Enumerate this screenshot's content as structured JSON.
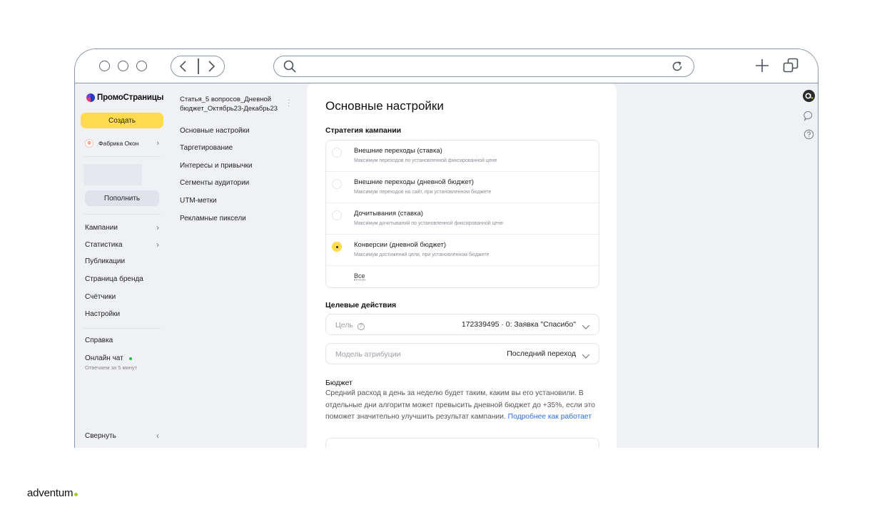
{
  "sidebar": {
    "logo": "ПромоСтраницы",
    "create_label": "Создать",
    "account_name": "Фабрика Окон",
    "account_avatar_letter": "Ф",
    "topup_label": "Пополнить",
    "items": [
      {
        "label": "Кампании"
      },
      {
        "label": "Статистика"
      },
      {
        "label": "Публикации"
      },
      {
        "label": "Страница бренда"
      },
      {
        "label": "Счётчики"
      },
      {
        "label": "Настройки"
      }
    ],
    "help_label": "Справка",
    "chat_label": "Онлайн чат",
    "chat_sub": "Отвечаем за 5 минут",
    "collapse_label": "Свернуть"
  },
  "subnav": {
    "campaign_title": "Статья_5 вопросов_Дневной бюджет_Октябрь23-Декабрь23",
    "items": [
      {
        "label": "Основные настройки"
      },
      {
        "label": "Таргетирование"
      },
      {
        "label": "Интересы и привычки"
      },
      {
        "label": "Сегменты аудитории"
      },
      {
        "label": "UTM-метки"
      },
      {
        "label": "Рекламные пиксели"
      }
    ]
  },
  "main": {
    "title": "Основные настройки",
    "strategy_label": "Стратегия кампании",
    "strategies": [
      {
        "title": "Внешние переходы (ставка)",
        "subtitle": "Максимум переходов по установленной фиксированной цене",
        "selected": false
      },
      {
        "title": "Внешние переходы (дневной бюджет)",
        "subtitle": "Максимум переходов на сайт, при установленном бюджете",
        "selected": false
      },
      {
        "title": "Дочитывания (ставка)",
        "subtitle": "Максимум дочитываний по установленной фиксированной цене",
        "selected": false
      },
      {
        "title": "Конверсии (дневной бюджет)",
        "subtitle": "Максимум достижений цели, при установленном бюджете",
        "selected": true
      }
    ],
    "all_link": "Все",
    "target_label": "Целевые действия",
    "goal_label": "Цель",
    "goal_value": "172339495 · 0: Заявка \"Спасибо\"",
    "attribution_label": "Модель атрибуции",
    "attribution_value": "Последний переход",
    "budget_label": "Бюджет",
    "budget_text": "Средний расход в день за неделю будет таким, каким вы его установили. В отдельные дни алгоритм может превысить дневной бюджет до +35%, если это поможет значительно улучшить результат кампании.",
    "budget_link": "Подробнее как работает"
  },
  "footer": {
    "brand": "adventum"
  },
  "colors": {
    "accent_yellow": "#ffdb4d",
    "link_blue": "#2d6ddf",
    "app_background": "#f0f1f5",
    "online_green": "#2ab950"
  },
  "icons": [
    "search-icon",
    "reload-icon",
    "new-tab-plus-icon",
    "windows-icon",
    "back-chevron-icon",
    "forward-chevron-icon",
    "user-avatar-icon",
    "chat-bubble-icon",
    "help-circle-icon",
    "chevron-down-icon"
  ]
}
